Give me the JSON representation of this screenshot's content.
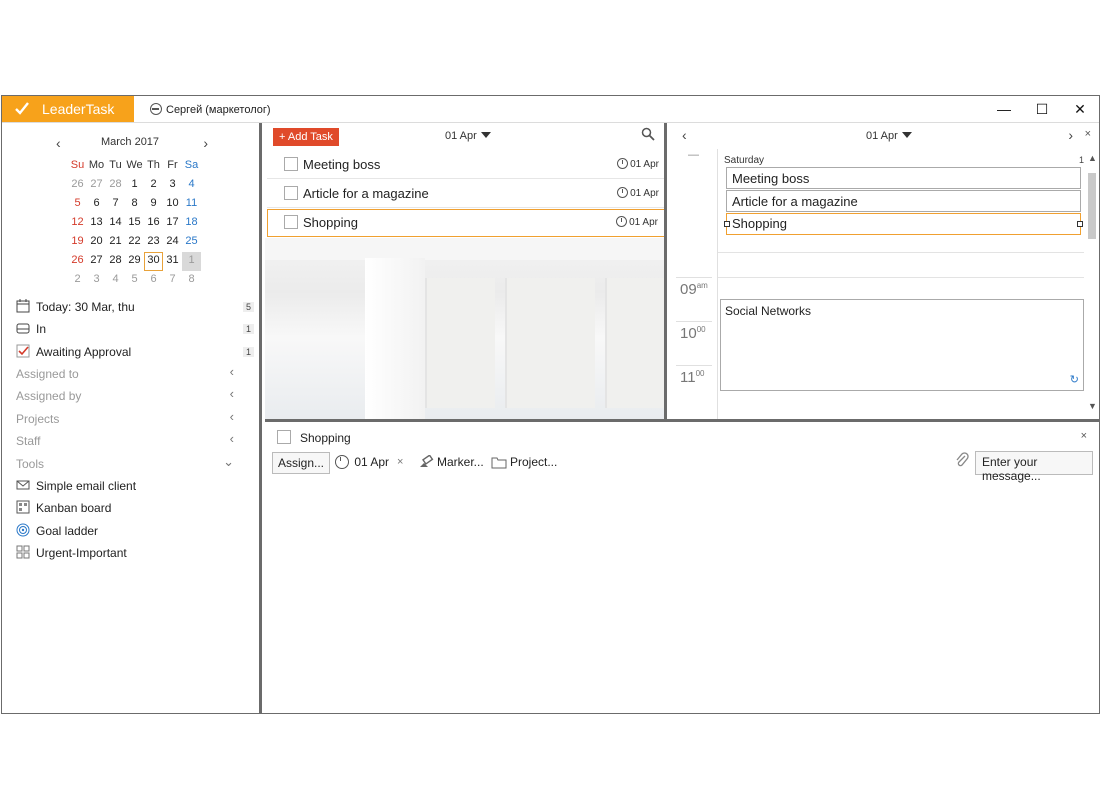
{
  "titlebar": {
    "app_name": "LeaderTask",
    "user_label": "Сергей (маркетолог)",
    "minimize": "—",
    "maximize": "☐",
    "close": "✕"
  },
  "calendar": {
    "title": "March 2017",
    "prev": "‹",
    "next": "›",
    "weekdays": [
      "Su",
      "Mo",
      "Tu",
      "We",
      "Th",
      "Fr",
      "Sa"
    ],
    "weeks": [
      [
        "26",
        "27",
        "28",
        "1",
        "2",
        "3",
        "4"
      ],
      [
        "5",
        "6",
        "7",
        "8",
        "9",
        "10",
        "11"
      ],
      [
        "12",
        "13",
        "14",
        "15",
        "16",
        "17",
        "18"
      ],
      [
        "19",
        "20",
        "21",
        "22",
        "23",
        "24",
        "25"
      ],
      [
        "26",
        "27",
        "28",
        "29",
        "30",
        "31",
        "1"
      ],
      [
        "2",
        "3",
        "4",
        "5",
        "6",
        "7",
        "8"
      ]
    ],
    "today": "30",
    "selected": "1"
  },
  "sidebar": {
    "items": [
      {
        "label": "Today: 30 Mar, thu",
        "count": "5",
        "icon": "calendar-icon"
      },
      {
        "label": "In",
        "count": "1",
        "icon": "inbox-icon"
      },
      {
        "label": "Awaiting Approval",
        "count": "1",
        "icon": "checkbox-checked-icon"
      }
    ],
    "sections": [
      {
        "label": "Assigned to",
        "chevron": "‹"
      },
      {
        "label": "Assigned by",
        "chevron": "‹"
      },
      {
        "label": "Projects",
        "chevron": "‹"
      },
      {
        "label": "Staff",
        "chevron": "‹"
      },
      {
        "label": "Tools",
        "chevron": "⌄"
      }
    ],
    "tools": [
      {
        "label": "Simple email client",
        "icon": "envelope-icon"
      },
      {
        "label": "Kanban board",
        "icon": "kanban-icon"
      },
      {
        "label": "Goal ladder",
        "icon": "target-icon"
      },
      {
        "label": "Urgent-Important",
        "icon": "grid-icon"
      }
    ]
  },
  "tasks": {
    "add_label": "+ Add Task",
    "date": "01 Apr",
    "items": [
      {
        "title": "Meeting boss",
        "due": "01 Apr"
      },
      {
        "title": "Article for a magazine",
        "due": "01 Apr"
      },
      {
        "title": "Shopping",
        "due": "01 Apr"
      }
    ]
  },
  "day": {
    "prev": "‹",
    "next": "›",
    "close": "×",
    "date": "01 Apr",
    "weekday": "Saturday",
    "count": "1",
    "collapse": "—",
    "events": [
      "Meeting boss",
      "Article for a magazine",
      "Shopping"
    ],
    "hours": [
      {
        "h": "09",
        "m": "am"
      },
      {
        "h": "10",
        "m": "00"
      },
      {
        "h": "11",
        "m": "00"
      }
    ],
    "timed_event": "Social Networks",
    "sync_icon": "↻"
  },
  "detail": {
    "title": "Shopping",
    "close": "×",
    "assign": "Assign...",
    "date": "01 Apr",
    "date_clear": "×",
    "marker": "Marker...",
    "project": "Project...",
    "message_placeholder": "Enter your message..."
  },
  "colors": {
    "brand": "#f7a21b",
    "add_task": "#e04a2a",
    "selection": "#f0a030",
    "sunday": "#d43a2a",
    "saturday": "#2a78c8"
  }
}
